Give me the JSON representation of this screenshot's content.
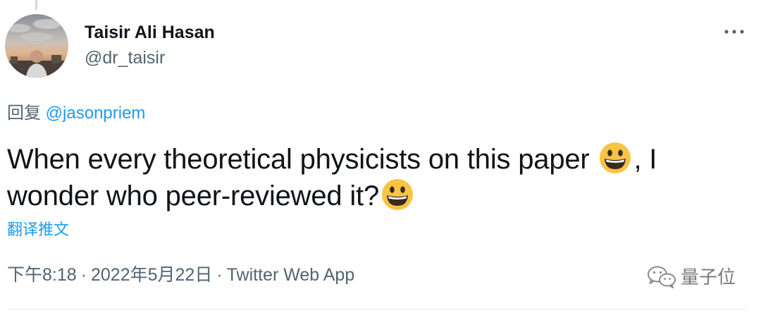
{
  "author": {
    "display_name": "Taisir Ali Hasan",
    "handle": "@dr_taisir"
  },
  "reply": {
    "prefix": "回复",
    "mention": "@jasonpriem"
  },
  "tweet": {
    "text_part1": "When every theoretical physicists on this paper ",
    "text_part2": ", I wonder who peer-reviewed it?",
    "emoji": "grinning-face-emoji"
  },
  "translate_label": "翻译推文",
  "meta": {
    "time": "下午8:18",
    "separator": "·",
    "date": "2022年5月22日",
    "source": "Twitter Web App"
  },
  "watermark": {
    "text": "量子位",
    "icon": "wechat-logo-icon"
  },
  "icons": {
    "more": "more-horizontal-icon"
  },
  "colors": {
    "text_primary": "#0f1419",
    "text_secondary": "#536471",
    "link_blue": "#1d9bf0",
    "emoji_yellow": "#f7c444"
  }
}
